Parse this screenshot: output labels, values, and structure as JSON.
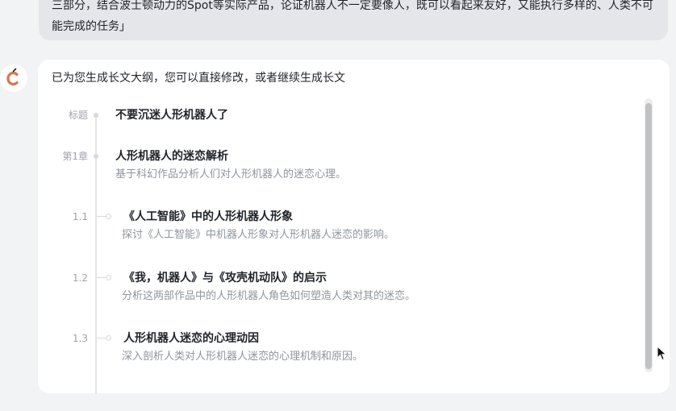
{
  "user_message": {
    "line1": "三部分，结合波士顿动力的Spot等实际产品，论证机器人不一定要像人，既可以看起来友好，又能执行多样的、人类不可",
    "line2": "能完成的任务」"
  },
  "assistant": {
    "avatar_icon": "assistant-logo-icon",
    "intro": "已为您生成长文大纲，您可以直接修改，或者继续生成长文"
  },
  "outline": {
    "items": [
      {
        "num": "标题",
        "title": "不要沉迷人形机器人了",
        "desc": ""
      },
      {
        "num": "第1章",
        "title": "人形机器人的迷恋解析",
        "desc": "基于科幻作品分析人们对人形机器人的迷恋心理。"
      },
      {
        "num": "1.1",
        "title": "《人工智能》中的人形机器人形象",
        "desc": "探讨《人工智能》中机器人形象对人形机器人迷恋的影响。"
      },
      {
        "num": "1.2",
        "title": "《我，机器人》与《攻壳机动队》的启示",
        "desc": "分析这两部作品中的人形机器人角色如何塑造人类对其的迷恋。"
      },
      {
        "num": "1.3",
        "title": "人形机器人迷恋的心理动因",
        "desc": "深入剖析人类对人形机器人迷恋的心理机制和原因。"
      }
    ]
  },
  "colors": {
    "page_bg": "#f2f3f5",
    "bubble_bg": "#e5e6ea",
    "card_bg": "#ffffff",
    "avatar_accent": "#d9774b"
  }
}
